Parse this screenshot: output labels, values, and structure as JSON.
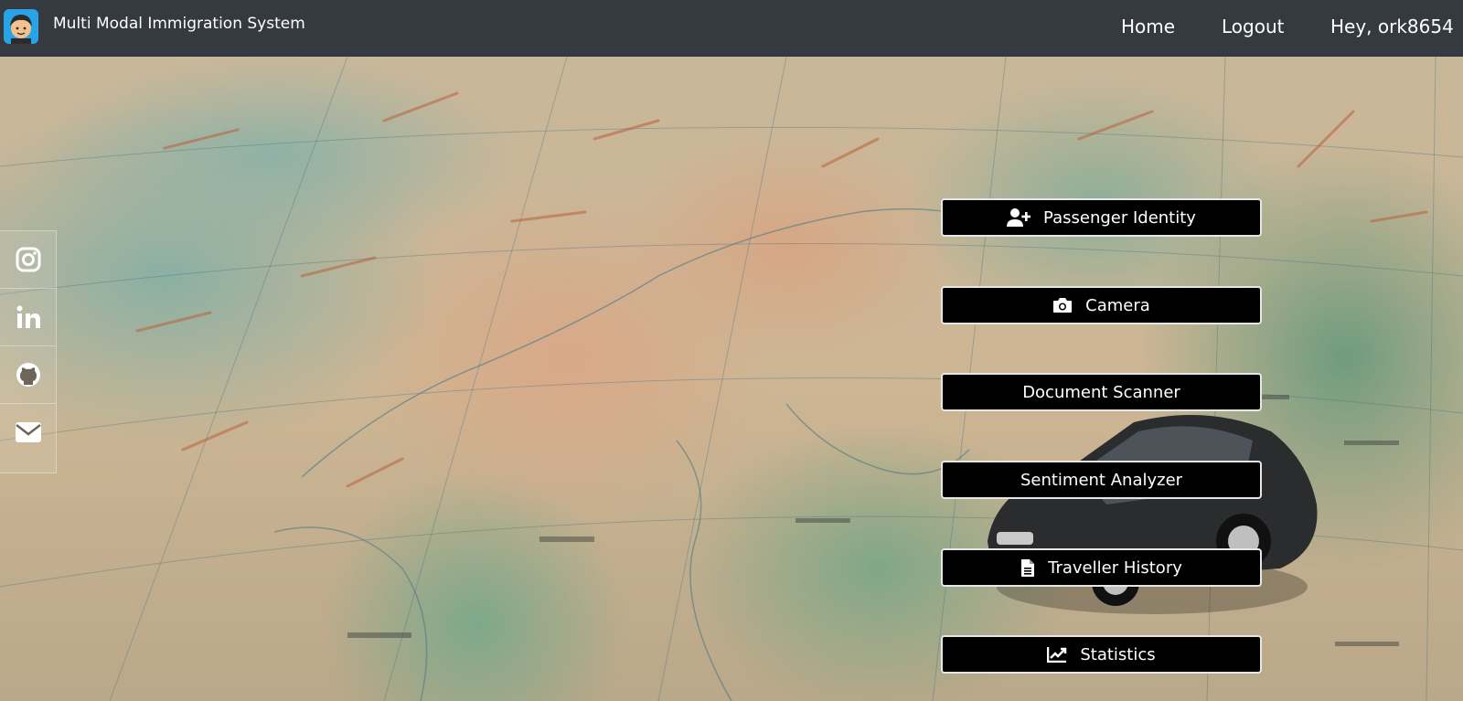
{
  "navbar": {
    "brand_title": "Multi Modal Immigration System",
    "links": {
      "home": "Home",
      "logout": "Logout",
      "user_greeting": "Hey, ork8654"
    }
  },
  "social": {
    "items": [
      {
        "icon": "instagram-icon"
      },
      {
        "icon": "linkedin-icon"
      },
      {
        "icon": "github-icon"
      },
      {
        "icon": "envelope-icon"
      }
    ]
  },
  "actions": {
    "passenger_identity": {
      "label": "Passenger Identity",
      "icon": "user-plus-icon"
    },
    "camera": {
      "label": "Camera",
      "icon": "camera-icon"
    },
    "document_scanner": {
      "label": "Document Scanner"
    },
    "sentiment_analyzer": {
      "label": "Sentiment Analyzer"
    },
    "traveller_history": {
      "label": "Traveller History",
      "icon": "file-text-icon"
    },
    "statistics": {
      "label": "Statistics",
      "icon": "chart-line-icon"
    }
  },
  "colors": {
    "navbar_bg": "#343a40",
    "button_bg": "#000000",
    "button_border": "#e6e6e6",
    "text": "#ffffff"
  }
}
